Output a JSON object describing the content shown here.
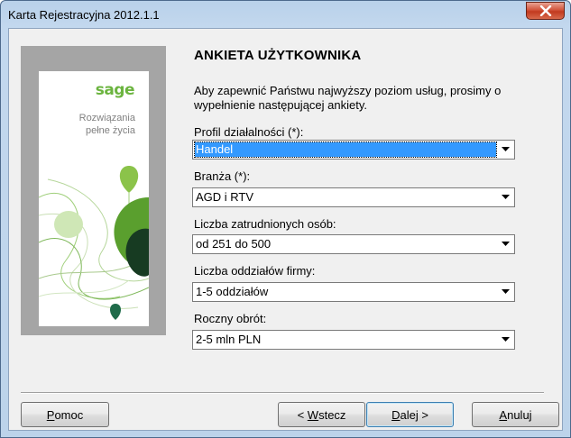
{
  "window": {
    "title": "Karta Rejestracyjna 2012.1.1"
  },
  "side": {
    "logo": "sage",
    "tagline_line1": "Rozwiązania",
    "tagline_line2": "pełne życia"
  },
  "main": {
    "heading": "ANKIETA UŻYTKOWNIKA",
    "intro": "Aby zapewnić Państwu najwyższy poziom usług, prosimy o wypełnienie następującej ankiety.",
    "fields": [
      {
        "label": "Profil działalności (*):",
        "value": "Handel"
      },
      {
        "label": "Branża (*):",
        "value": "AGD i RTV"
      },
      {
        "label": "Liczba zatrudnionych osób:",
        "value": "od 251 do 500"
      },
      {
        "label": "Liczba oddziałów firmy:",
        "value": "1-5 oddziałów"
      },
      {
        "label": "Roczny obrót:",
        "value": "2-5 mln PLN"
      }
    ]
  },
  "buttons": {
    "help_m": "P",
    "help_rest": "omoc",
    "back_prefix": "< ",
    "back_m": "W",
    "back_rest": "stecz",
    "next_m": "D",
    "next_rest": "alej >",
    "cancel_m": "A",
    "cancel_rest": "nuluj"
  },
  "colors": {
    "selection": "#3399ff",
    "brand_green": "#6bb43f",
    "close_red": "#c23a1f"
  }
}
